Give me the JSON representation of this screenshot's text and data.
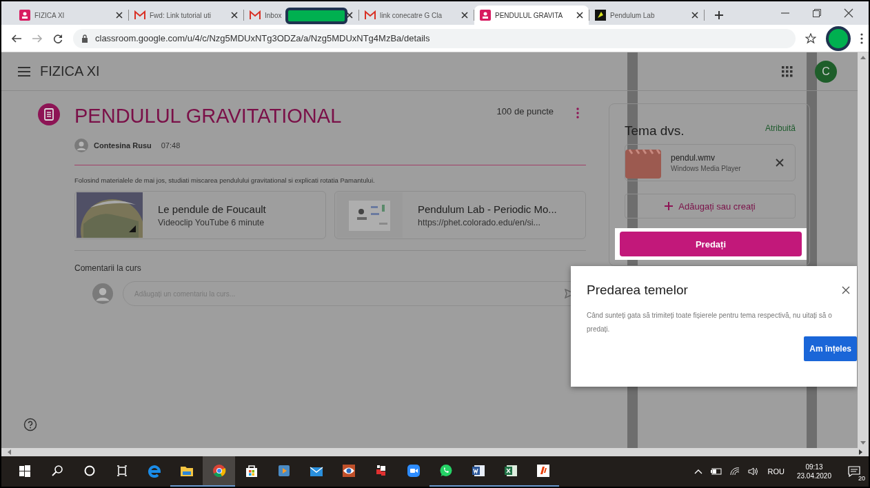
{
  "browser": {
    "tabs": [
      {
        "title": "FIZICA XI",
        "kind": "classroom",
        "selected": false,
        "redacted": false
      },
      {
        "title": "Fwd: Link tutorial uti",
        "kind": "gmail",
        "selected": false,
        "redacted": false
      },
      {
        "title": "Inbox",
        "kind": "gmail",
        "selected": false,
        "redacted": true
      },
      {
        "title": "link conecatre G Cla",
        "kind": "gmail",
        "selected": false,
        "redacted": false
      },
      {
        "title": "PENDULUL GRAVITA",
        "kind": "classroom",
        "selected": true,
        "redacted": false
      },
      {
        "title": "Pendulum Lab",
        "kind": "phet",
        "selected": false,
        "redacted": false
      }
    ],
    "address": "classroom.google.com/u/4/c/Nzg5MDUxNTg3ODZa/a/Nzg5MDUxNTg4MzBa/details"
  },
  "class_header": {
    "title": "FIZICA XI",
    "avatar": "C"
  },
  "assignment": {
    "title": "PENDULUL GRAVITATIONAL",
    "points": "100 de puncte",
    "author": "Contesina Rusu",
    "time": "07:48",
    "instructions": "Folosind materialele de mai jos, studiati miscarea pendulului gravitational si explicati rotatia Pamantului.",
    "attachments": [
      {
        "kind": "video",
        "title": "Le pendule de Foucault",
        "subtitle": "Videoclip YouTube   6 minute"
      },
      {
        "kind": "link",
        "title": "Pendulum Lab - Periodic Mo...",
        "subtitle": "https://phet.colorado.edu/en/si..."
      }
    ],
    "comments_label": "Comentarii la curs",
    "comment_placeholder": "Adăugați un comentariu la curs..."
  },
  "your_work": {
    "title": "Tema dvs.",
    "status": "Atribuită",
    "file": {
      "name": "pendul.wmv",
      "type": "Windows Media Player"
    },
    "add_button": "Adăugați sau creați",
    "submit_button": "Predați"
  },
  "popup": {
    "title": "Predarea temelor",
    "body": "Când sunteți gata să trimiteți toate fișierele pentru tema respectivă, nu uitați să o predați.",
    "button": "Am înțeles"
  },
  "taskbar": {
    "items": [
      {
        "kind": "start",
        "selected": false,
        "running": false
      },
      {
        "kind": "search",
        "selected": false,
        "running": false
      },
      {
        "kind": "cortana",
        "selected": false,
        "running": false
      },
      {
        "kind": "taskview",
        "selected": false,
        "running": false
      },
      {
        "kind": "edge",
        "selected": false,
        "running": false
      },
      {
        "kind": "explorer",
        "selected": false,
        "running": true
      },
      {
        "kind": "chrome",
        "selected": true,
        "running": true
      },
      {
        "kind": "store",
        "selected": false,
        "running": false
      },
      {
        "kind": "media",
        "selected": false,
        "running": false
      },
      {
        "kind": "mail",
        "selected": false,
        "running": false
      },
      {
        "kind": "viewer",
        "selected": false,
        "running": false
      },
      {
        "kind": "puzzle",
        "selected": false,
        "running": false
      },
      {
        "kind": "zoom",
        "selected": false,
        "running": false
      },
      {
        "kind": "whatsapp",
        "selected": false,
        "running": true
      },
      {
        "kind": "word",
        "selected": false,
        "running": true
      },
      {
        "kind": "excel",
        "selected": false,
        "running": true
      },
      {
        "kind": "office",
        "selected": false,
        "running": true
      }
    ],
    "tray": {
      "language": "ROU",
      "time": "09:13",
      "date": "23.04.2020",
      "notifications": "20"
    }
  }
}
